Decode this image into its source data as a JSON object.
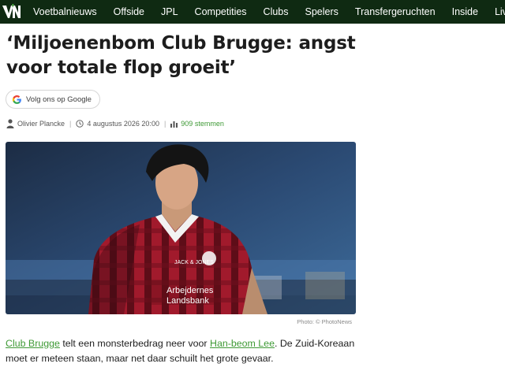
{
  "brand": {
    "logo_text": "VN",
    "accent": "#3f9a36",
    "nav_bg": "#0f2a12"
  },
  "nav": {
    "items": [
      "Voetbalnieuws",
      "Offside",
      "JPL",
      "Competities",
      "Clubs",
      "Spelers",
      "Transfergeruchten",
      "Inside",
      "Livescore"
    ]
  },
  "article": {
    "title_line1": "‘Miljoenenbom Club Brugge: angst",
    "title_line2": "voor totale flop groeit’",
    "follow_label": "Volg ons op Google",
    "author": "Olivier Plancke",
    "date": "4 augustus 2026 20:00",
    "votes": "909 stemmen",
    "photo": {
      "shirt_sponsor_1": "JACK & JONES",
      "shirt_sponsor_2a": "Arbejdernes",
      "shirt_sponsor_2b": "Landsbank"
    },
    "photo_credit": "Photo: © PhotoNews",
    "lead": {
      "link1": "Club Brugge",
      "text1": " telt een monsterbedrag neer voor ",
      "link2": "Han-beom Lee",
      "text2": ". De Zuid-Koreaan moet er meteen staan, maar net daar schuilt het grote gevaar."
    }
  }
}
